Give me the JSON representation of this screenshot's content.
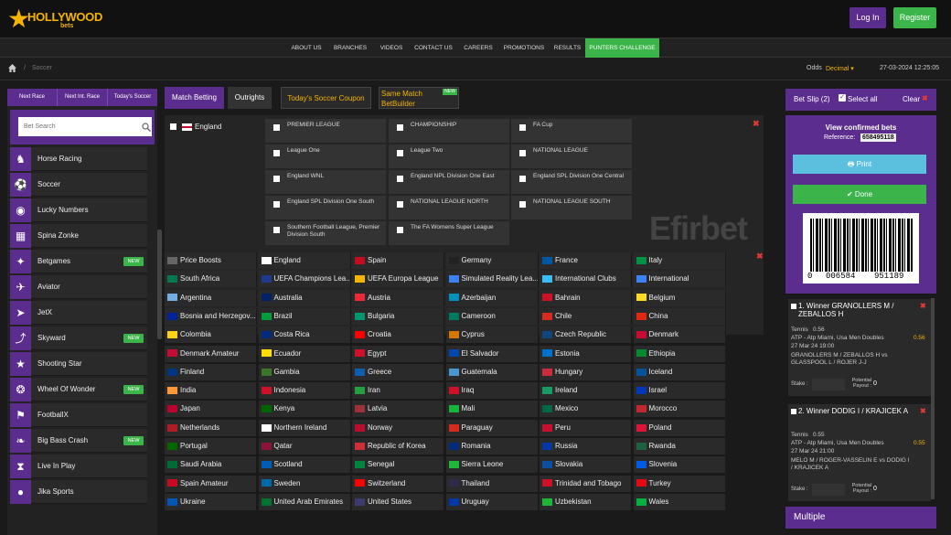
{
  "brand": {
    "name": "HOLLYWOOD",
    "sub": "bets"
  },
  "auth": {
    "login": "Log In",
    "register": "Register"
  },
  "nav": [
    "ABOUT US",
    "BRANCHES",
    "VIDEOS",
    "CONTACT US",
    "CAREERS",
    "PROMOTIONS",
    "RESULTS",
    "PUNTERS CHALLENGE"
  ],
  "breadcrumb": {
    "sep": "/",
    "current": "Soccer"
  },
  "odds": {
    "label": "Odds",
    "value": "Decimal ▾"
  },
  "datetime": "27-03-2024 12:25:05",
  "quicklinks": [
    "Next Race",
    "Next Int. Race",
    "Today's Soccer"
  ],
  "search": {
    "placeholder": "Bet Search"
  },
  "games": [
    {
      "label": "Horse Racing",
      "icon": "horse-icon",
      "new": ""
    },
    {
      "label": "Soccer",
      "icon": "soccer-ball-icon",
      "new": ""
    },
    {
      "label": "Lucky Numbers",
      "icon": "lottery-balls-icon",
      "new": ""
    },
    {
      "label": "Spina Zonke",
      "icon": "slot-machine-icon",
      "new": ""
    },
    {
      "label": "Betgames",
      "icon": "betgames-icon",
      "new": "NEW"
    },
    {
      "label": "Aviator",
      "icon": "plane-icon",
      "new": ""
    },
    {
      "label": "JetX",
      "icon": "jet-icon",
      "new": ""
    },
    {
      "label": "Skyward",
      "icon": "skyward-icon",
      "new": "NEW"
    },
    {
      "label": "Shooting Star",
      "icon": "star-icon",
      "new": ""
    },
    {
      "label": "Wheel Of Wonder",
      "icon": "wheel-icon",
      "new": "NEW"
    },
    {
      "label": "FootballX",
      "icon": "footballer-icon",
      "new": ""
    },
    {
      "label": "Big Bass Crash",
      "icon": "fish-icon",
      "new": "NEW"
    },
    {
      "label": "Live In Play",
      "icon": "hourglass-icon",
      "new": ""
    },
    {
      "label": "Jika Sports",
      "icon": "sports-ball-icon",
      "new": ""
    }
  ],
  "tabs": {
    "match_betting": "Match Betting",
    "outrights": "Outrights",
    "coupon": "Today's Soccer Coupon",
    "smb_line1": "Same Match",
    "smb_line2": "BetBuilder",
    "new": "NEW"
  },
  "country_selected": "England",
  "leagues": [
    "PREMIER LEAGUE",
    "CHAMPIONSHIP",
    "FA Cup",
    "League One",
    "League Two",
    "NATIONAL LEAGUE",
    "England WNL",
    "England NPL Division One East",
    "England SPL Division One Central",
    "England SPL Division One South",
    "NATIONAL LEAGUE NORTH",
    "NATIONAL LEAGUE SOUTH",
    "Southern Football League, Premier Division South",
    "The FA Womens Super League"
  ],
  "watermark": "Efirbet",
  "countries": [
    "Price Boosts",
    "England",
    "Spain",
    "Germany",
    "France",
    "Italy",
    "South Africa",
    "UEFA Champions Lea...",
    "UEFA Europa League",
    "Simulated Reality Lea...",
    "International Clubs",
    "International",
    "Argentina",
    "Australia",
    "Austria",
    "Azerbaijan",
    "Bahrain",
    "Belgium",
    "Bosnia and Herzegov...",
    "Brazil",
    "Bulgaria",
    "Cameroon",
    "Chile",
    "China",
    "Colombia",
    "Costa Rica",
    "Croatia",
    "Cyprus",
    "Czech Republic",
    "Denmark",
    "Denmark Amateur",
    "Ecuador",
    "Egypt",
    "El Salvador",
    "Estonia",
    "Ethiopia",
    "Finland",
    "Gambia",
    "Greece",
    "Guatemala",
    "Hungary",
    "Iceland",
    "India",
    "Indonesia",
    "Iran",
    "Iraq",
    "Ireland",
    "Israel",
    "Japan",
    "Kenya",
    "Latvia",
    "Mali",
    "Mexico",
    "Morocco",
    "Netherlands",
    "Northern Ireland",
    "Norway",
    "Paraguay",
    "Peru",
    "Poland",
    "Portugal",
    "Qatar",
    "Republic of Korea",
    "Romania",
    "Russia",
    "Rwanda",
    "Saudi Arabia",
    "Scotland",
    "Senegal",
    "Sierra Leone",
    "Slovakia",
    "Slovenia",
    "Spain Amateur",
    "Sweden",
    "Switzerland",
    "Thailand",
    "Trinidad and Tobago",
    "Turkey",
    "Ukraine",
    "United Arab Emirates",
    "United States",
    "Uruguay",
    "Uzbekistan",
    "Wales"
  ],
  "flag_colors": [
    "#666",
    "#fff",
    "#c60b1e",
    "#222",
    "#0055a4",
    "#009246",
    "#007a4d",
    "#1e3a8a",
    "#f4b400",
    "#3b82f6",
    "#38bdf8",
    "#3b82f6",
    "#74acdf",
    "#012169",
    "#ed2939",
    "#0092bc",
    "#ce1126",
    "#fdda24",
    "#002395",
    "#009c3b",
    "#00966e",
    "#007a5e",
    "#d52b1e",
    "#de2910",
    "#fcd116",
    "#002b7f",
    "#ff0000",
    "#d57800",
    "#11457e",
    "#c60c30",
    "#c60c30",
    "#ffdd00",
    "#ce1126",
    "#0047ab",
    "#0072ce",
    "#078930",
    "#003580",
    "#3a7728",
    "#0d5eaf",
    "#4997d0",
    "#cd2a3e",
    "#02529c",
    "#ff9933",
    "#ce1126",
    "#239f40",
    "#ce1126",
    "#169b62",
    "#0038b8",
    "#bc002d",
    "#006600",
    "#9e3039",
    "#14b53a",
    "#006847",
    "#c1272d",
    "#ae1c28",
    "#fff",
    "#ba0c2f",
    "#d52b1e",
    "#c8102e",
    "#dc143c",
    "#006600",
    "#8a1538",
    "#cd2e3a",
    "#002b7f",
    "#0039a6",
    "#20603d",
    "#006c35",
    "#005eb8",
    "#00853f",
    "#1eb53a",
    "#0b4ea2",
    "#005ce5",
    "#c60b1e",
    "#006aa7",
    "#ff0000",
    "#2d2a4a",
    "#ce1126",
    "#e30a17",
    "#0057b7",
    "#00732f",
    "#3c3b6e",
    "#0038a8",
    "#1eb53a",
    "#00b140"
  ],
  "betslip": {
    "title": "Bet Slip (2)",
    "select_all": "Select all",
    "clear": "Clear",
    "confirmed": "View confirmed bets",
    "reference_label": "Reference:",
    "reference": "658495118",
    "print": "Print",
    "done": "Done",
    "barcode_left": "0",
    "barcode_mid": "006584",
    "barcode_right": "951189",
    "bets": [
      {
        "title": "1. Winner GRANOLLERS M / ZEBALLOS H",
        "sport": "Tennis",
        "odd": "0.56",
        "event": "ATP - Atp Miami, Usa Men Doubles",
        "date": "27 Mar 24 19:00",
        "match": "GRANOLLERS M / ZEBALLOS H vs GLASSPOOL L / ROJER J-J",
        "odd_right": "0.56",
        "stake_label": "Stake :",
        "potential": "Potential Payout :",
        "payout": "0"
      },
      {
        "title": "2. Winner DODIG I / KRAJICEK A",
        "sport": "Tennis",
        "odd": "0.55",
        "event": "ATP - Atp Miami, Usa Men Doubles",
        "date": "27 Mar 24 21:00",
        "match": "MELO M / ROGER-VASSELIN E vs DODIG I / KRAJICEK A",
        "odd_right": "0.55",
        "stake_label": "Stake :",
        "potential": "Potential Payout :",
        "payout": "0"
      }
    ],
    "multiple": "Multiple"
  }
}
